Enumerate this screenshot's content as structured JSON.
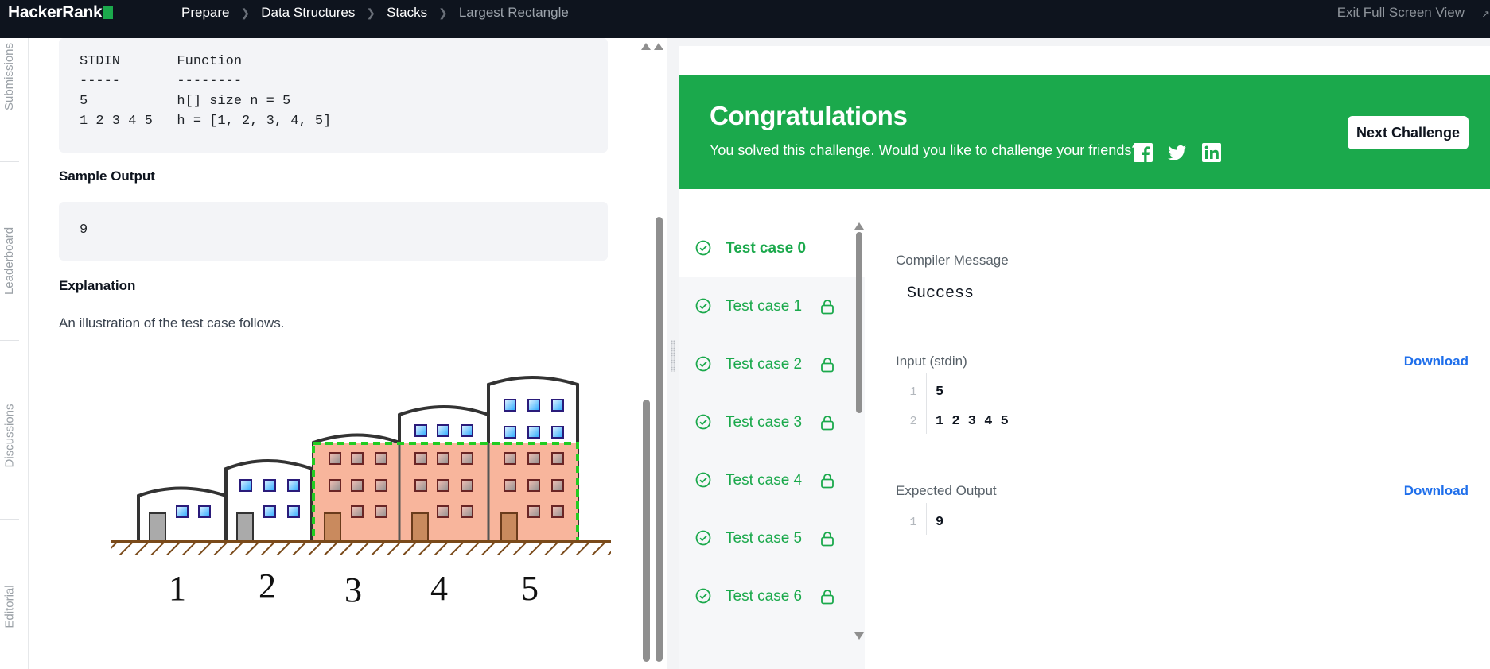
{
  "app": {
    "logo_text": "HackerRank"
  },
  "breadcrumbs": [
    "Prepare",
    "Data Structures",
    "Stacks",
    "Largest Rectangle"
  ],
  "header": {
    "exit_fullscreen": "Exit Full Screen View"
  },
  "siderail": {
    "tabs": [
      "Submissions",
      "Leaderboard",
      "Discussions",
      "Editorial"
    ]
  },
  "problem": {
    "sample_input_lines": [
      "STDIN       Function",
      "-----       --------",
      "5           h[] size n = 5",
      "1 2 3 4 5   h = [1, 2, 3, 4, 5]"
    ],
    "sample_output_heading": "Sample Output",
    "sample_output": "9",
    "explanation_heading": "Explanation",
    "explanation_text": "An illustration of the test case follows.",
    "illustration_labels": [
      "1",
      "2",
      "3",
      "4",
      "5"
    ]
  },
  "congrats": {
    "title": "Congratulations",
    "message": "You solved this challenge. Would you like to challenge your friends?",
    "next_button": "Next Challenge",
    "share_icons": [
      "facebook-icon",
      "twitter-icon",
      "linkedin-icon"
    ]
  },
  "testcases": [
    {
      "label": "Test case 0",
      "active": true,
      "locked": false
    },
    {
      "label": "Test case 1",
      "active": false,
      "locked": true
    },
    {
      "label": "Test case 2",
      "active": false,
      "locked": true
    },
    {
      "label": "Test case 3",
      "active": false,
      "locked": true
    },
    {
      "label": "Test case 4",
      "active": false,
      "locked": true
    },
    {
      "label": "Test case 5",
      "active": false,
      "locked": true
    },
    {
      "label": "Test case 6",
      "active": false,
      "locked": true
    }
  ],
  "result": {
    "compiler_label": "Compiler Message",
    "compiler_message": "Success",
    "input_label": "Input (stdin)",
    "input_lines": [
      {
        "num": "1",
        "text": "5"
      },
      {
        "num": "2",
        "text": "1 2 3 4 5"
      }
    ],
    "expected_label": "Expected Output",
    "expected_lines": [
      {
        "num": "1",
        "text": "9"
      }
    ],
    "download_label": "Download"
  },
  "colors": {
    "topbar": "#0e141e",
    "accent_green": "#1ba94c",
    "link_blue": "#1f6feb"
  }
}
